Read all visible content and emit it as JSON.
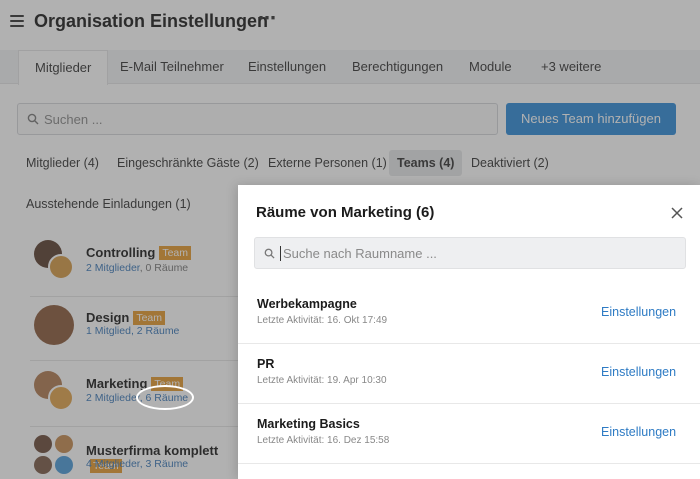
{
  "header": {
    "title": "Organisation Einstellungen",
    "more_label": "⋯"
  },
  "tabs": [
    {
      "label": "Mitglieder",
      "active": true
    },
    {
      "label": "E-Mail Teilnehmer"
    },
    {
      "label": "Einstellungen"
    },
    {
      "label": "Berechtigungen"
    },
    {
      "label": "Module"
    },
    {
      "label": "+3 weitere"
    }
  ],
  "search": {
    "placeholder": "Suchen ...",
    "icon": "search-icon"
  },
  "add_team_button": "Neues Team hinzufügen",
  "filters": [
    {
      "label": "Mitglieder (4)"
    },
    {
      "label": "Eingeschränkte Gäste (2)"
    },
    {
      "label": "Externe Personen (1)"
    },
    {
      "label": "Teams (4)",
      "active": true
    },
    {
      "label": "Deaktiviert (2)"
    }
  ],
  "pending_invites": "Ausstehende Einladungen (1)",
  "teams": [
    {
      "name": "Controlling",
      "badge": "Team",
      "members": "2 Mitglieder",
      "rooms": "0 Räume"
    },
    {
      "name": "Design",
      "badge": "Team",
      "members": "1 Mitglied",
      "rooms": "2 Räume"
    },
    {
      "name": "Marketing",
      "badge": "Team",
      "members": "2 Mitglieder",
      "rooms": "6 Räume"
    },
    {
      "name": "Musterfirma komplett",
      "badge": "Team",
      "members": "4 Mitglieder",
      "rooms": "3 Räume"
    }
  ],
  "separator": ", ",
  "modal": {
    "title": "Räume von Marketing (6)",
    "search_placeholder": "Suche nach Raumname ...",
    "rooms": [
      {
        "name": "Werbekampagne",
        "activity": "Letzte Aktivität: 16. Okt 17:49",
        "action": "Einstellungen"
      },
      {
        "name": "PR",
        "activity": "Letzte Aktivität: 19. Apr 10:30",
        "action": "Einstellungen"
      },
      {
        "name": "Marketing Basics",
        "activity": "Letzte Aktivität: 16. Dez 15:58",
        "action": "Einstellungen"
      }
    ]
  },
  "colors": {
    "accent": "#2e8bd8",
    "badge": "#e69a2e",
    "link": "#2e7bc4"
  }
}
